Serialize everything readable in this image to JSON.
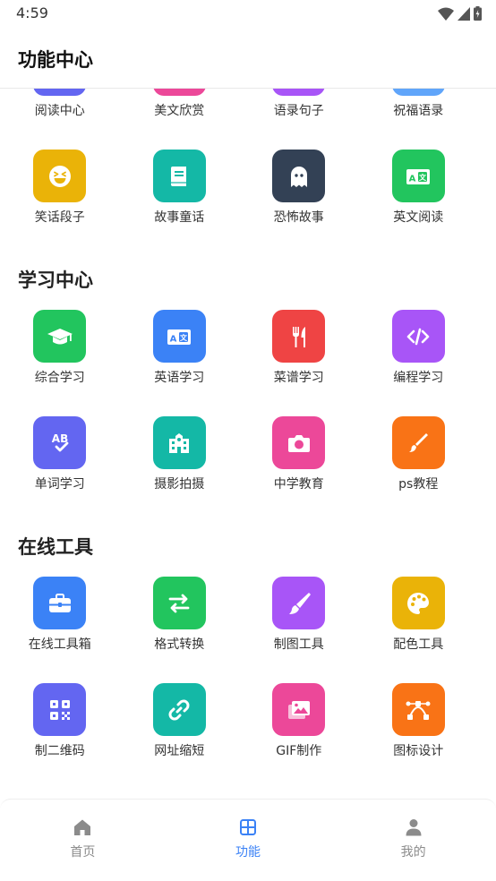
{
  "status_bar": {
    "time": "4:59"
  },
  "header": {
    "title": "功能中心"
  },
  "sections": [
    {
      "title": "",
      "items": [
        {
          "label": "阅读中心",
          "icon": "book-icon",
          "color": "#6366f1"
        },
        {
          "label": "美文欣赏",
          "icon": "heart-icon",
          "color": "#ec4899"
        },
        {
          "label": "语录句子",
          "icon": "quote-icon",
          "color": "#a855f7"
        },
        {
          "label": "祝福语录",
          "icon": "gift-icon",
          "color": "#60a5fa"
        },
        {
          "label": "笑话段子",
          "icon": "laugh-icon",
          "color": "#eab308"
        },
        {
          "label": "故事童话",
          "icon": "storybook-icon",
          "color": "#14b8a6"
        },
        {
          "label": "恐怖故事",
          "icon": "ghost-icon",
          "color": "#334155"
        },
        {
          "label": "英文阅读",
          "icon": "translate-icon",
          "color": "#22c55e"
        }
      ]
    },
    {
      "title": "学习中心",
      "items": [
        {
          "label": "综合学习",
          "icon": "graduation-cap-icon",
          "color": "#22c55e"
        },
        {
          "label": "英语学习",
          "icon": "translate-icon",
          "color": "#3b82f6"
        },
        {
          "label": "菜谱学习",
          "icon": "utensils-icon",
          "color": "#ef4444"
        },
        {
          "label": "编程学习",
          "icon": "code-icon",
          "color": "#a855f7"
        },
        {
          "label": "单词学习",
          "icon": "spellcheck-icon",
          "color": "#6366f1"
        },
        {
          "label": "摄影拍摄",
          "icon": "school-building-icon",
          "color": "#14b8a6"
        },
        {
          "label": "中学教育",
          "icon": "camera-icon",
          "color": "#ec4899"
        },
        {
          "label": "ps教程",
          "icon": "brush-icon",
          "color": "#f97316"
        }
      ]
    },
    {
      "title": "在线工具",
      "items": [
        {
          "label": "在线工具箱",
          "icon": "toolbox-icon",
          "color": "#3b82f6"
        },
        {
          "label": "格式转换",
          "icon": "swap-arrows-icon",
          "color": "#22c55e"
        },
        {
          "label": "制图工具",
          "icon": "paintbrush-icon",
          "color": "#a855f7"
        },
        {
          "label": "配色工具",
          "icon": "palette-icon",
          "color": "#eab308"
        },
        {
          "label": "制二维码",
          "icon": "qrcode-icon",
          "color": "#6366f1"
        },
        {
          "label": "网址缩短",
          "icon": "link-icon",
          "color": "#14b8a6"
        },
        {
          "label": "GIF制作",
          "icon": "images-icon",
          "color": "#ec4899"
        },
        {
          "label": "图标设计",
          "icon": "bezier-curve-icon",
          "color": "#f97316"
        }
      ]
    }
  ],
  "tabbar": {
    "tabs": [
      {
        "label": "首页",
        "icon": "home-icon",
        "active": false
      },
      {
        "label": "功能",
        "icon": "grid-icon",
        "active": true
      },
      {
        "label": "我的",
        "icon": "user-icon",
        "active": false
      }
    ],
    "active_color": "#3b82f6",
    "inactive_color": "#8b8b8b"
  }
}
